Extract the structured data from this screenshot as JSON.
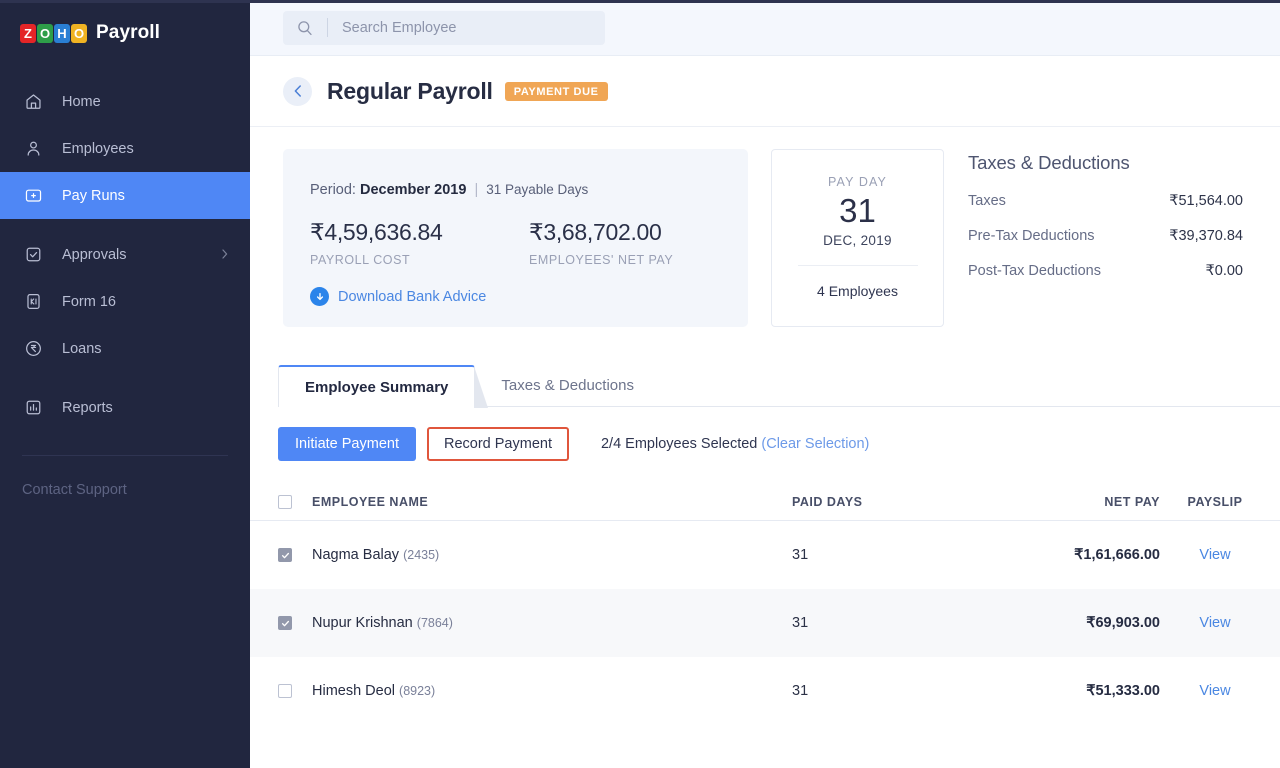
{
  "brand": {
    "logo_tiles": [
      {
        "ch": "Z",
        "color": "#e42527"
      },
      {
        "ch": "O",
        "color": "#2e9e49"
      },
      {
        "ch": "H",
        "color": "#2a7fd4"
      },
      {
        "ch": "O",
        "color": "#f0b323"
      }
    ],
    "product": "Payroll"
  },
  "sidebar": {
    "items": [
      {
        "label": "Home",
        "icon": "home-icon",
        "active": false,
        "chevron": false
      },
      {
        "label": "Employees",
        "icon": "user-icon",
        "active": false,
        "chevron": false
      },
      {
        "label": "Pay Runs",
        "icon": "payrun-icon",
        "active": true,
        "chevron": false
      },
      {
        "label": "Approvals",
        "icon": "checkbox-doc-icon",
        "active": false,
        "chevron": true
      },
      {
        "label": "Form 16",
        "icon": "form-icon",
        "active": false,
        "chevron": false
      },
      {
        "label": "Loans",
        "icon": "rupee-circle-icon",
        "active": false,
        "chevron": false
      },
      {
        "label": "Reports",
        "icon": "report-icon",
        "active": false,
        "chevron": false
      }
    ],
    "footer_link": "Contact Support",
    "active_color": "#4f87f5",
    "background": "#21263f"
  },
  "search": {
    "placeholder": "Search Employee",
    "value": ""
  },
  "header": {
    "back_label": "‹",
    "title": "Regular Payroll",
    "badge": "PAYMENT DUE",
    "badge_color": "#f0a655"
  },
  "summary": {
    "period_prefix": "Period:",
    "period_value": "December 2019",
    "period_days": "31 Payable Days",
    "payroll_cost_value": "₹4,59,636.84",
    "payroll_cost_label": "PAYROLL COST",
    "net_pay_value": "₹3,68,702.00",
    "net_pay_label": "EMPLOYEES' NET PAY",
    "download_link": "Download Bank Advice"
  },
  "payday": {
    "label": "PAY DAY",
    "day": "31",
    "month_year": "DEC, 2019",
    "employees": "4 Employees"
  },
  "taxes": {
    "title": "Taxes & Deductions",
    "rows": [
      {
        "name": "Taxes",
        "value": "₹51,564.00"
      },
      {
        "name": "Pre-Tax Deductions",
        "value": "₹39,370.84"
      },
      {
        "name": "Post-Tax Deductions",
        "value": "₹0.00"
      }
    ]
  },
  "tabs": [
    {
      "label": "Employee Summary",
      "active": true
    },
    {
      "label": "Taxes & Deductions",
      "active": false
    }
  ],
  "actions": {
    "initiate_label": "Initiate Payment",
    "record_label": "Record Payment",
    "record_highlight_color": "#e0563c",
    "selection_text": "2/4 Employees Selected",
    "clear_selection": "(Clear Selection)"
  },
  "table": {
    "columns": [
      "EMPLOYEE NAME",
      "PAID DAYS",
      "NET PAY",
      "PAYSLIP"
    ],
    "header_checkbox_checked": false,
    "rows": [
      {
        "checked": true,
        "name": "Nagma Balay",
        "emp_id": "(2435)",
        "paid_days": "31",
        "net_pay": "₹1,61,666.00",
        "payslip": "View"
      },
      {
        "checked": true,
        "name": "Nupur Krishnan",
        "emp_id": "(7864)",
        "paid_days": "31",
        "net_pay": "₹69,903.00",
        "payslip": "View"
      },
      {
        "checked": false,
        "name": "Himesh Deol",
        "emp_id": "(8923)",
        "paid_days": "31",
        "net_pay": "₹51,333.00",
        "payslip": "View"
      }
    ]
  }
}
